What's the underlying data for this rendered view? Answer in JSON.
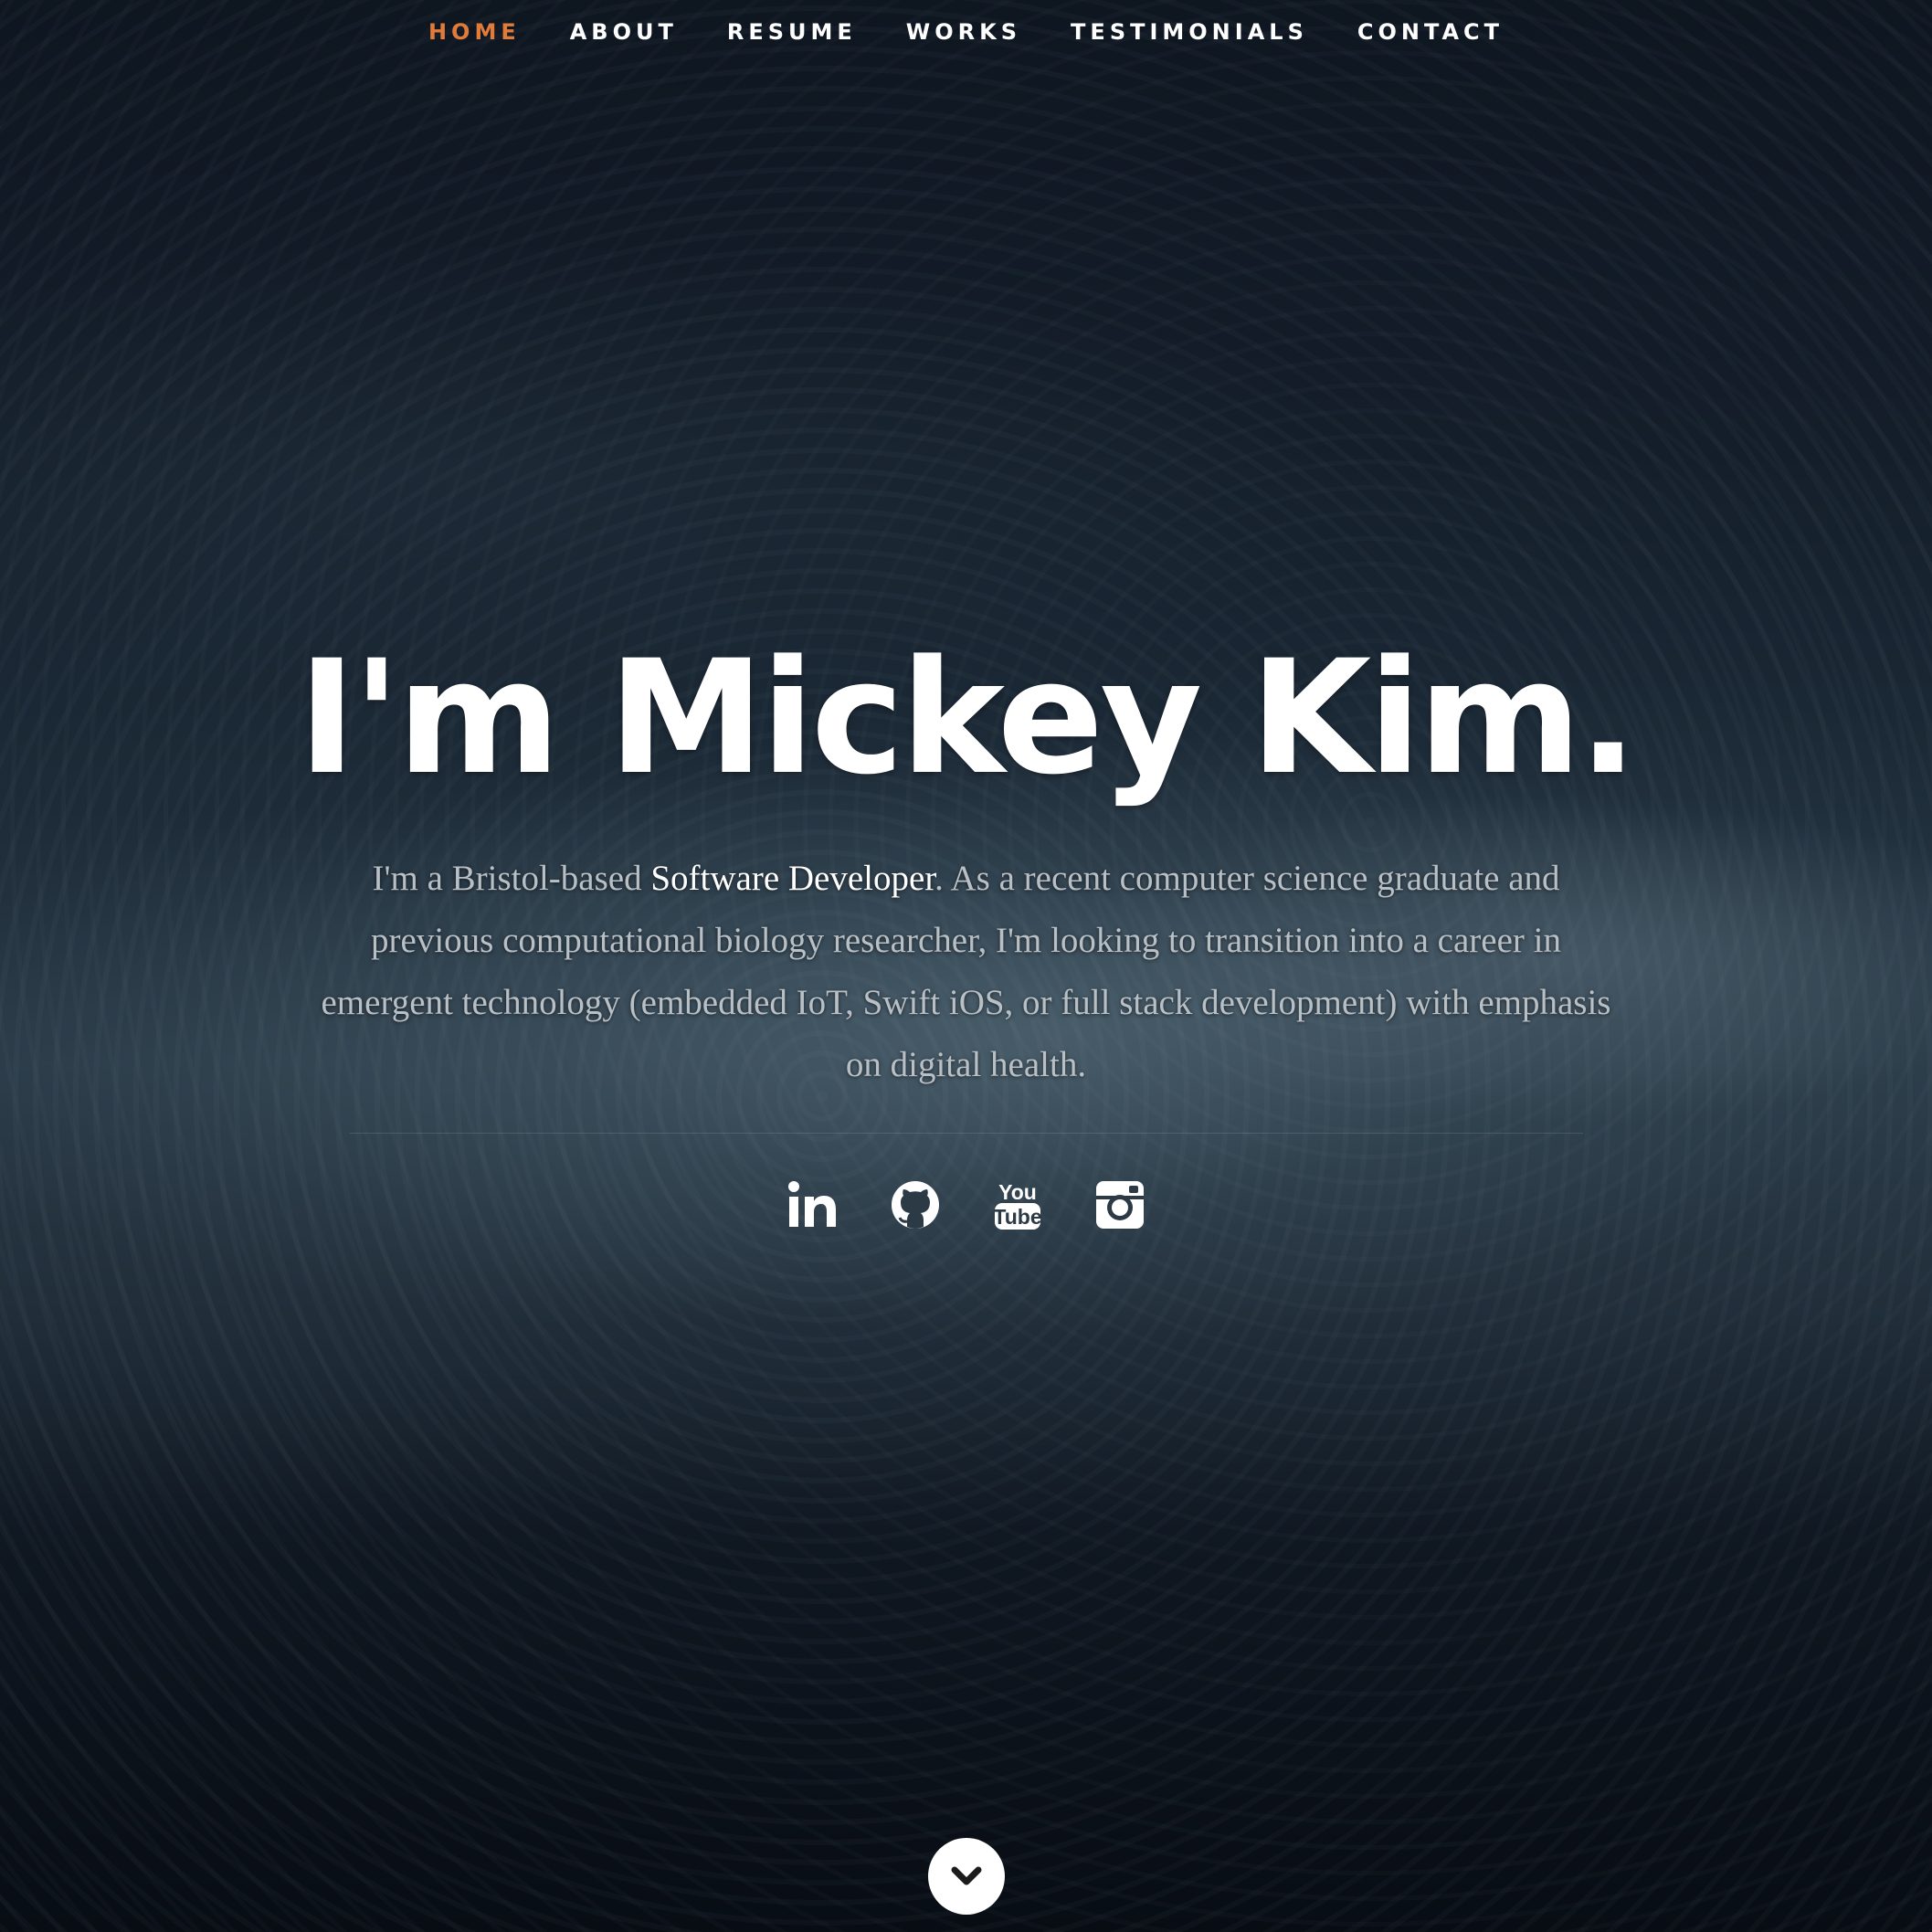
{
  "nav": {
    "items": [
      {
        "label": "HOME",
        "active": true
      },
      {
        "label": "ABOUT",
        "active": false
      },
      {
        "label": "RESUME",
        "active": false
      },
      {
        "label": "WORKS",
        "active": false
      },
      {
        "label": "TESTIMONIALS",
        "active": false
      },
      {
        "label": "CONTACT",
        "active": false
      }
    ]
  },
  "banner": {
    "headline": "I'm Mickey Kim.",
    "intro_before": "I'm a Bristol-based ",
    "intro_highlight": "Software Developer",
    "intro_after": ". As a recent computer science graduate and previous computational biology researcher, I'm looking to transition into a career in emergent technology (embedded IoT, Swift iOS, or full stack development) with emphasis on digital health."
  },
  "social": {
    "icons": [
      "linkedin-icon",
      "github-icon",
      "youtube-icon",
      "instagram-icon"
    ]
  },
  "colors": {
    "accent": "#e07b39",
    "text": "#ffffff",
    "muted_text": "#b8c0c6"
  }
}
